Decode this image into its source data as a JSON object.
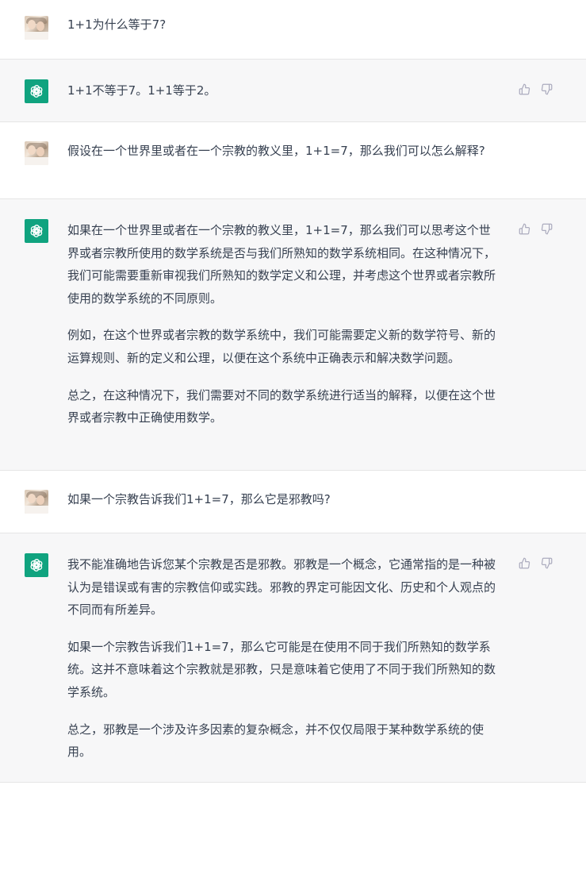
{
  "conversation": {
    "messages": [
      {
        "role": "user",
        "avatar": "user-photo-avatar",
        "paragraphs": [
          "1+1为什么等于7?"
        ]
      },
      {
        "role": "assistant",
        "avatar": "chatgpt-logo-icon",
        "paragraphs": [
          "1+1不等于7。1+1等于2。"
        ]
      },
      {
        "role": "user",
        "avatar": "user-photo-avatar",
        "paragraphs": [
          "假设在一个世界里或者在一个宗教的教义里，1+1=7，那么我们可以怎么解释?"
        ]
      },
      {
        "role": "assistant",
        "avatar": "chatgpt-logo-icon",
        "paragraphs": [
          "如果在一个世界里或者在一个宗教的教义里，1+1=7，那么我们可以思考这个世界或者宗教所使用的数学系统是否与我们所熟知的数学系统相同。在这种情况下，我们可能需要重新审视我们所熟知的数学定义和公理，并考虑这个世界或者宗教所使用的数学系统的不同原则。",
          "例如，在这个世界或者宗教的数学系统中，我们可能需要定义新的数学符号、新的运算规则、新的定义和公理，以便在这个系统中正确表示和解决数学问题。",
          "总之，在这种情况下，我们需要对不同的数学系统进行适当的解释，以便在这个世界或者宗教中正确使用数学。"
        ]
      },
      {
        "role": "user",
        "avatar": "user-photo-avatar",
        "paragraphs": [
          "如果一个宗教告诉我们1+1=7，那么它是邪教吗?"
        ]
      },
      {
        "role": "assistant",
        "avatar": "chatgpt-logo-icon",
        "paragraphs": [
          "我不能准确地告诉您某个宗教是否是邪教。邪教是一个概念，它通常指的是一种被认为是错误或有害的宗教信仰或实践。邪教的界定可能因文化、历史和个人观点的不同而有所差异。",
          "如果一个宗教告诉我们1+1=7，那么它可能是在使用不同于我们所熟知的数学系统。这并不意味着这个宗教就是邪教，只是意味着它使用了不同于我们所熟知的数学系统。",
          "总之，邪教是一个涉及许多因素的复杂概念，并不仅仅局限于某种数学系统的使用。"
        ]
      }
    ]
  },
  "icons": {
    "thumbs_up": "thumbs-up-icon",
    "thumbs_down": "thumbs-down-icon"
  },
  "colors": {
    "bot_row_bg": "#f7f7f8",
    "user_row_bg": "#ffffff",
    "bot_avatar_bg": "#10a37f",
    "text": "#374151",
    "icon": "#acacbe"
  }
}
